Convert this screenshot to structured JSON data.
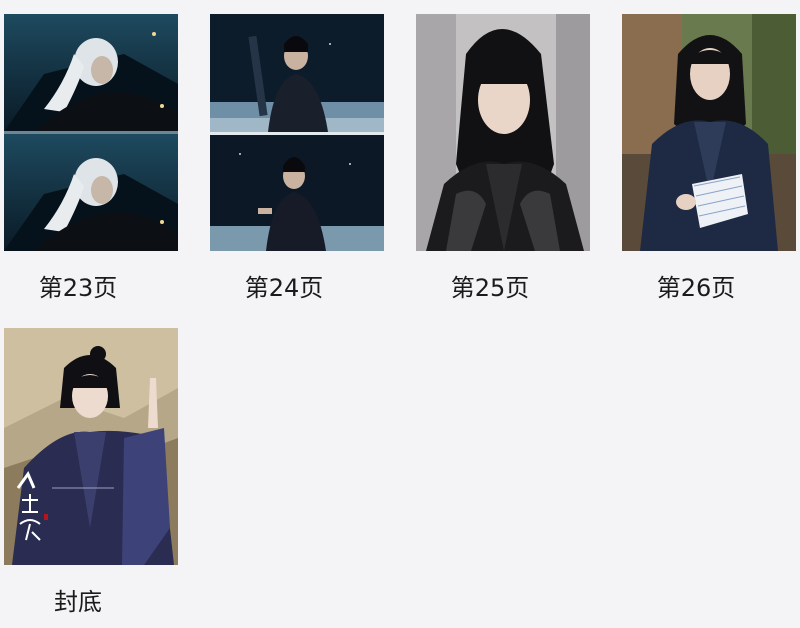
{
  "pages": [
    {
      "label": "第23页",
      "thumbnail_icon": "portrait-white-hair-dark-cape-icon",
      "palette": {
        "bg": "#0f2433",
        "accent": "#d9dde2"
      }
    },
    {
      "label": "第24页",
      "thumbnail_icon": "portrait-sword-night-scene-icon",
      "palette": {
        "bg": "#0c1a28",
        "accent": "#2c3e5a"
      }
    },
    {
      "label": "第25页",
      "thumbnail_icon": "portrait-long-black-hair-icon",
      "palette": {
        "bg": "#bfbcbc",
        "accent": "#1a1a1a"
      }
    },
    {
      "label": "第26页",
      "thumbnail_icon": "portrait-reading-script-icon",
      "palette": {
        "bg": "#5b6b43",
        "accent": "#1d2a44"
      }
    },
    {
      "label": "封底",
      "thumbnail_icon": "poster-back-cover-icon",
      "palette": {
        "bg": "#b9a98a",
        "accent": "#2b2e52"
      }
    }
  ]
}
